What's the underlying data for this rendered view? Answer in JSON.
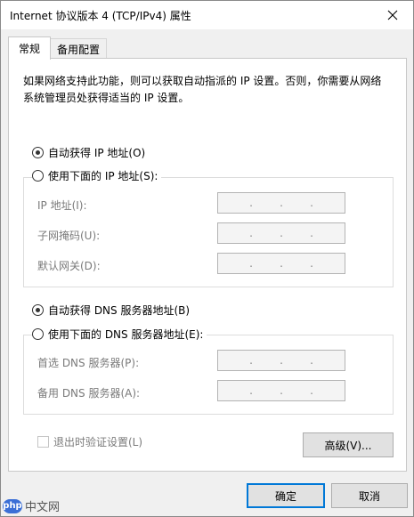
{
  "window": {
    "title": "Internet 协议版本 4 (TCP/IPv4) 属性"
  },
  "tabs": [
    {
      "label": "常规"
    },
    {
      "label": "备用配置"
    }
  ],
  "description": "如果网络支持此功能，则可以获取自动指派的 IP 设置。否则，你需要从网络系统管理员处获得适当的 IP 设置。",
  "ip": {
    "auto_label": "自动获得 IP 地址(O)",
    "manual_label": "使用下面的 IP 地址(S):",
    "selected": "auto",
    "fields": [
      {
        "label": "IP 地址(I):",
        "value": ". . ."
      },
      {
        "label": "子网掩码(U):",
        "value": ". . ."
      },
      {
        "label": "默认网关(D):",
        "value": ". . ."
      }
    ]
  },
  "dns": {
    "auto_label": "自动获得 DNS 服务器地址(B)",
    "manual_label": "使用下面的 DNS 服务器地址(E):",
    "selected": "auto",
    "fields": [
      {
        "label": "首选 DNS 服务器(P):",
        "value": ". . ."
      },
      {
        "label": "备用 DNS 服务器(A):",
        "value": ". . ."
      }
    ]
  },
  "validate_checkbox": {
    "label": "退出时验证设置(L)",
    "checked": false
  },
  "buttons": {
    "advanced": "高级(V)...",
    "ok": "确定",
    "cancel": "取消"
  },
  "watermark": {
    "logo": "php",
    "text": "中文网"
  }
}
